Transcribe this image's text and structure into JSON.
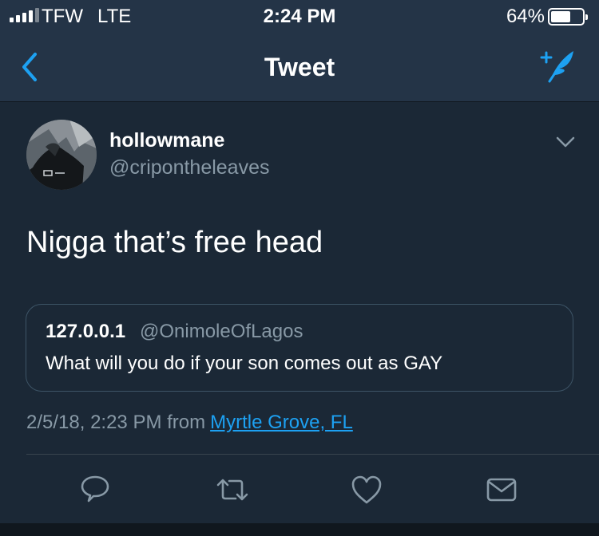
{
  "status_bar": {
    "carrier": "TFW",
    "network": "LTE",
    "time": "2:24 PM",
    "battery": "64%",
    "battery_level": 0.64
  },
  "nav": {
    "title": "Tweet",
    "back_icon": "chevron-left-icon",
    "compose_icon": "compose-tweet-icon"
  },
  "tweet": {
    "display_name": "hollowmane",
    "username": "@cripontheleaves",
    "text": "Nigga that’s free head",
    "quote": {
      "display_name": "127.0.0.1",
      "username": "@OnimoleOfLagos",
      "text": "What will you do if your son comes out as GAY"
    },
    "timestamp": "2/5/18, 2:23 PM from",
    "location": "Myrtle Grove, FL"
  },
  "actions": [
    "reply-icon",
    "retweet-icon",
    "like-icon",
    "message-icon"
  ],
  "colors": {
    "background": "#1b2836",
    "nav": "#243447",
    "accent": "#1da1f2",
    "muted": "#8899a6"
  }
}
